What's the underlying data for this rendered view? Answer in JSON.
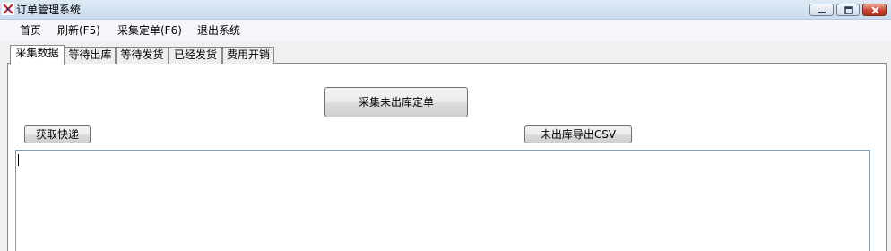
{
  "window": {
    "title": "订单管理系统",
    "icon": "app-logo-icon",
    "controls": [
      "minimize-icon",
      "maximize-icon",
      "close-icon"
    ]
  },
  "menu": {
    "items": [
      {
        "label": "首页"
      },
      {
        "label": "刷新(F5)"
      },
      {
        "label": "采集定单(F6)"
      },
      {
        "label": "退出系统"
      }
    ]
  },
  "tabs": {
    "items": [
      {
        "label": "采集数据",
        "active": true
      },
      {
        "label": "等待出库",
        "active": false
      },
      {
        "label": "等待发货",
        "active": false
      },
      {
        "label": "已经发货",
        "active": false
      },
      {
        "label": "费用开销",
        "active": false
      }
    ]
  },
  "page": {
    "collect_button": "采集未出库定单",
    "express_button": "获取快递",
    "csv_button": "未出库导出CSV",
    "output_text": ""
  },
  "colors": {
    "titlebar": "#c9dcef",
    "close_button": "#c8432b",
    "input_border": "#7f9db9"
  }
}
